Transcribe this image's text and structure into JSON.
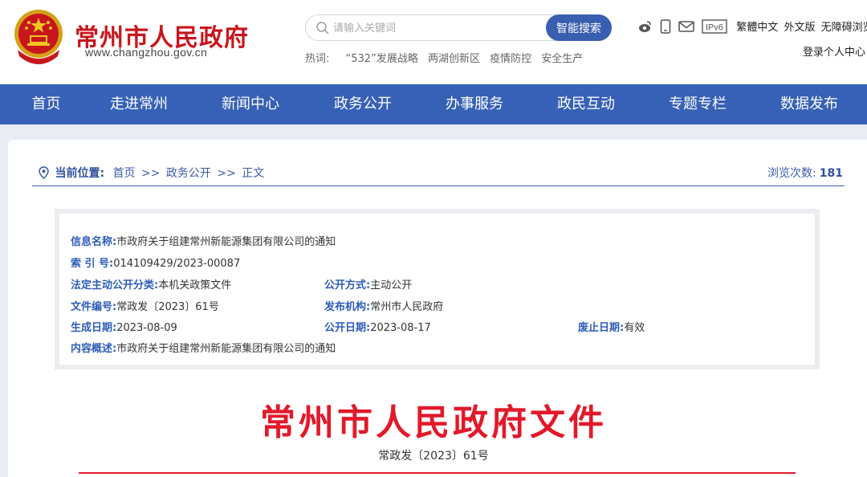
{
  "header": {
    "site_name": "常州市人民政府",
    "site_url": "www.changzhou.gov.cn",
    "search_placeholder": "请输入关键词",
    "search_button": "智能搜索",
    "hot_label": "热词:",
    "hot_words": [
      "“532”发展战略",
      "两湖创新区",
      "疫情防控",
      "安全生产"
    ],
    "tools": {
      "ipv6": "IPv6",
      "traditional": "繁體中文",
      "foreign": "外文版",
      "accessible": "无障碍浏览"
    },
    "login": "登录个人中心"
  },
  "nav": [
    "首页",
    "走进常州",
    "新闻中心",
    "政务公开",
    "办事服务",
    "政民互动",
    "专题专栏",
    "数据发布"
  ],
  "breadcrumb": {
    "label": "当前位置:",
    "items": [
      "首页",
      "政务公开",
      "正文"
    ],
    "separator": ">>",
    "views_label": "浏览次数:",
    "views": "181"
  },
  "info": {
    "name_k": "信息名称:",
    "name_v": "市政府关于组建常州新能源集团有限公司的通知",
    "index_k": "索 引 号:",
    "index_v": "014109429/2023-00087",
    "category_k": "法定主动公开分类:",
    "category_v": "本机关政策文件",
    "method_k": "公开方式:",
    "method_v": "主动公开",
    "docno_k": "文件编号:",
    "docno_v": "常政发〔2023〕61号",
    "issuer_k": "发布机构:",
    "issuer_v": "常州市人民政府",
    "created_k": "生成日期:",
    "created_v": "2023-08-09",
    "published_k": "公开日期:",
    "published_v": "2023-08-17",
    "expiry_k": "废止日期:",
    "expiry_v": "有效",
    "summary_k": "内容概述:",
    "summary_v": "市政府关于组建常州新能源集团有限公司的通知"
  },
  "document": {
    "title": "常州市人民政府文件",
    "number": "常政发〔2023〕61号"
  },
  "colors": {
    "brand_red": "#c8161d",
    "nav_blue": "#3761b6",
    "doc_red": "#e2192a",
    "key_blue": "#2d5cb8"
  }
}
